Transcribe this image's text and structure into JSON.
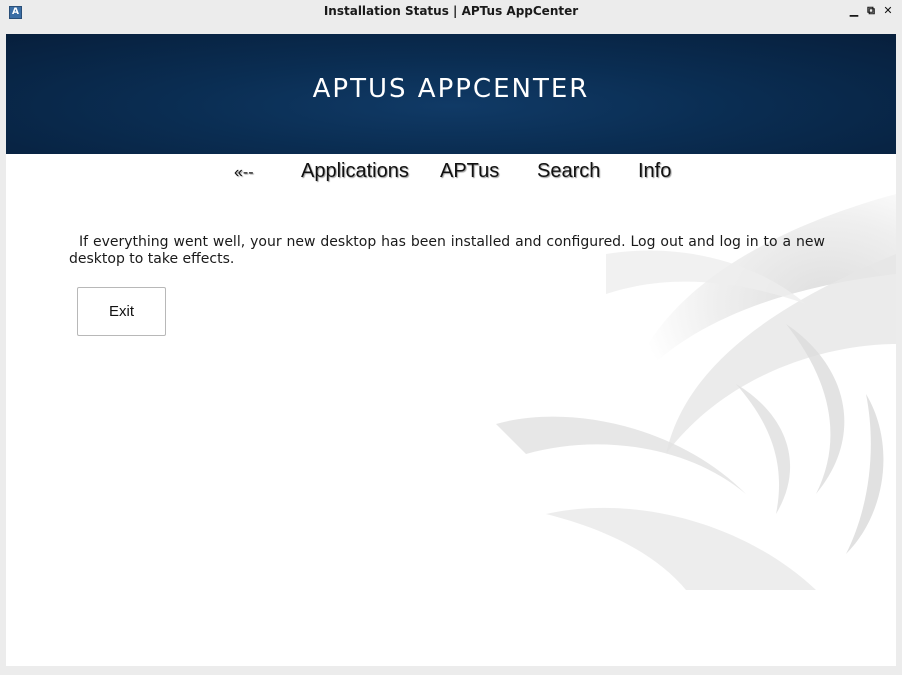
{
  "window": {
    "title": "Installation Status | APTus AppCenter",
    "icon_letter": "A",
    "controls": {
      "minimize": "▁",
      "maximize": "⧉",
      "close": "✕"
    }
  },
  "banner": {
    "title": "APTUS APPCENTER"
  },
  "nav": {
    "back": "«--",
    "items": [
      "Applications",
      "APTus",
      "Search",
      "Info"
    ]
  },
  "main": {
    "message": "If everything went well, your new desktop has been installed and configured. Log out and log in to a new desktop to take effects.",
    "exit_label": "Exit"
  },
  "colors": {
    "banner": "#0a2d52",
    "background": "#ffffff",
    "frame": "#ececec"
  }
}
